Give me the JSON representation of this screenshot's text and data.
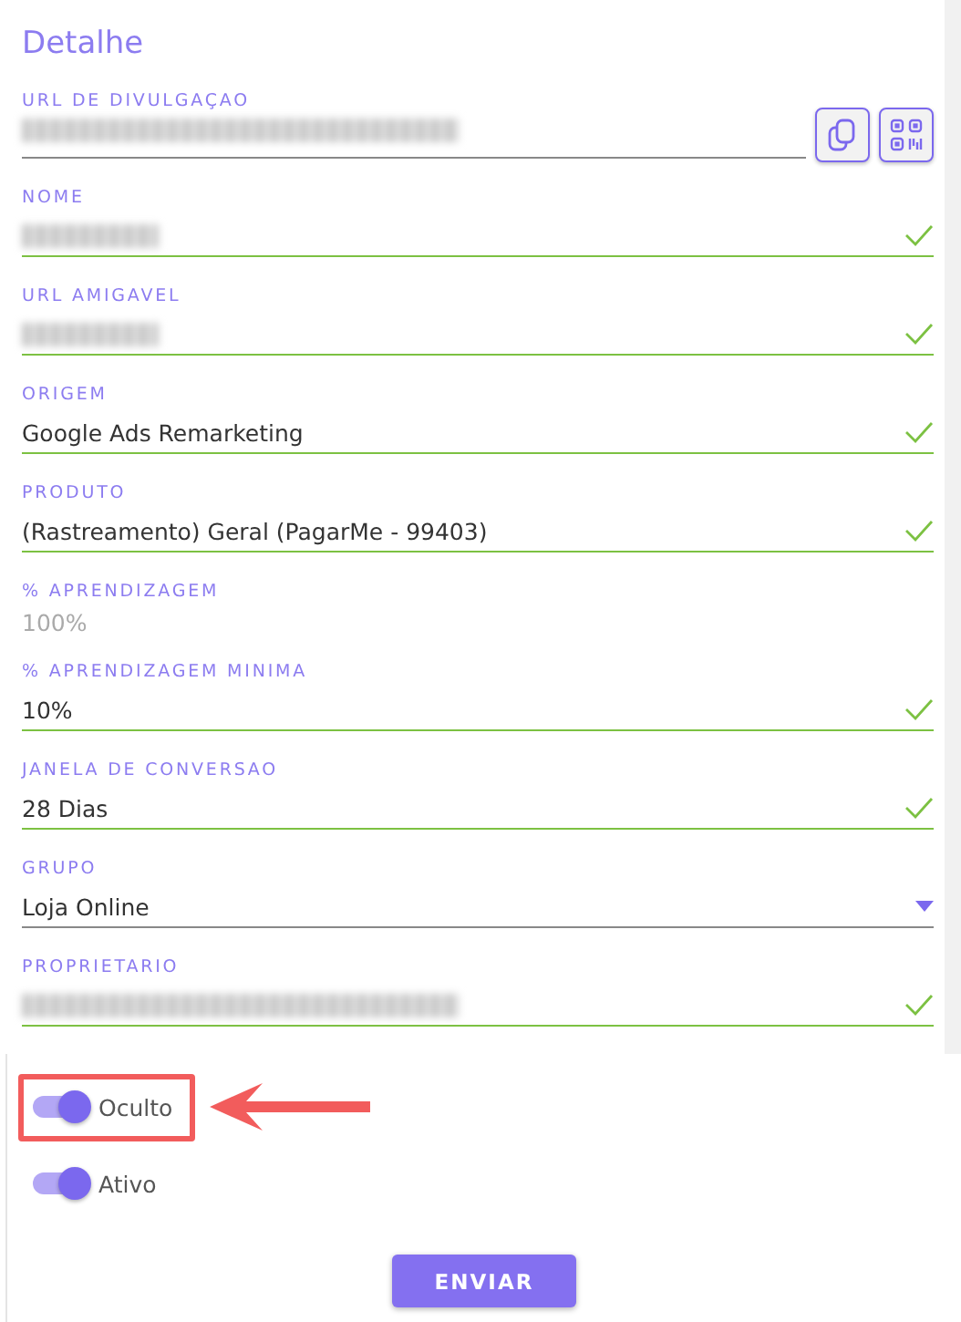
{
  "title": "Detalhe",
  "fields": [
    {
      "label": "URL DE DIVULGAÇAO",
      "kind": "url",
      "redacted": true,
      "valid": false
    },
    {
      "label": "NOME",
      "kind": "text",
      "redacted": true,
      "valid": true
    },
    {
      "label": "URL AMIGAVEL",
      "kind": "text",
      "redacted": true,
      "valid": true
    },
    {
      "label": "ORIGEM",
      "kind": "text",
      "value": "Google Ads Remarketing",
      "redacted": false,
      "valid": true
    },
    {
      "label": "PRODUTO",
      "kind": "text",
      "value": "(Rastreamento) Geral (PagarMe - 99403)",
      "redacted": false,
      "valid": true
    },
    {
      "label": "% APRENDIZAGEM",
      "kind": "readonly",
      "value": "100%"
    },
    {
      "label": "% APRENDIZAGEM MINIMA",
      "kind": "text",
      "value": "10%",
      "redacted": false,
      "valid": true
    },
    {
      "label": "JANELA DE CONVERSAO",
      "kind": "text",
      "value": "28 Dias",
      "redacted": false,
      "valid": true
    },
    {
      "label": "GRUPO",
      "kind": "select",
      "value": "Loja Online",
      "valid": false
    },
    {
      "label": "PROPRIETARIO",
      "kind": "text",
      "redacted": true,
      "valid": true
    }
  ],
  "toggles": [
    {
      "label": "Oculto",
      "on": true,
      "highlighted": true
    },
    {
      "label": "Ativo",
      "on": true,
      "highlighted": false
    }
  ],
  "submit": "ENVIAR"
}
